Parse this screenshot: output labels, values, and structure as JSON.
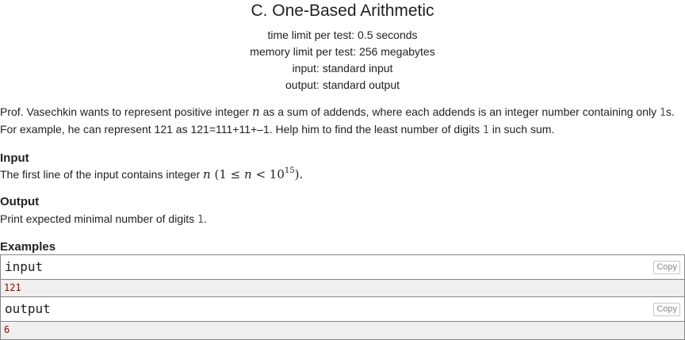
{
  "problem": {
    "title": "C. One-Based Arithmetic",
    "time_limit": "time limit per test: 0.5 seconds",
    "memory_limit": "memory limit per test: 256 megabytes",
    "input_spec": "input: standard input",
    "output_spec": "output: standard output"
  },
  "statement": {
    "p1_a": "Prof. Vasechkin wants to represent positive integer ",
    "p1_var": "n",
    "p1_b": " as a sum of addends, where each addends is an integer number containing only ",
    "p1_code": "1",
    "p1_c": "s.",
    "p2_a": "For example, he can represent 121 as 121=111+11+–1. Help him to find the least number of digits ",
    "p2_code": "1",
    "p2_b": " in such sum."
  },
  "input_section": {
    "heading": "Input",
    "text_a": "The first line of the input contains integer ",
    "var": "n",
    "paren_open": " (1 ≤ ",
    "var2": "n",
    "lt": " < 10",
    "exp": "15",
    "paren_close": ")."
  },
  "output_section": {
    "heading": "Output",
    "text_a": "Print expected minimal number of digits ",
    "code": "1",
    "text_b": "."
  },
  "examples": {
    "heading": "Examples",
    "input_label": "input",
    "input_value": "121",
    "output_label": "output",
    "output_value": "6",
    "copy_label": "Copy"
  }
}
